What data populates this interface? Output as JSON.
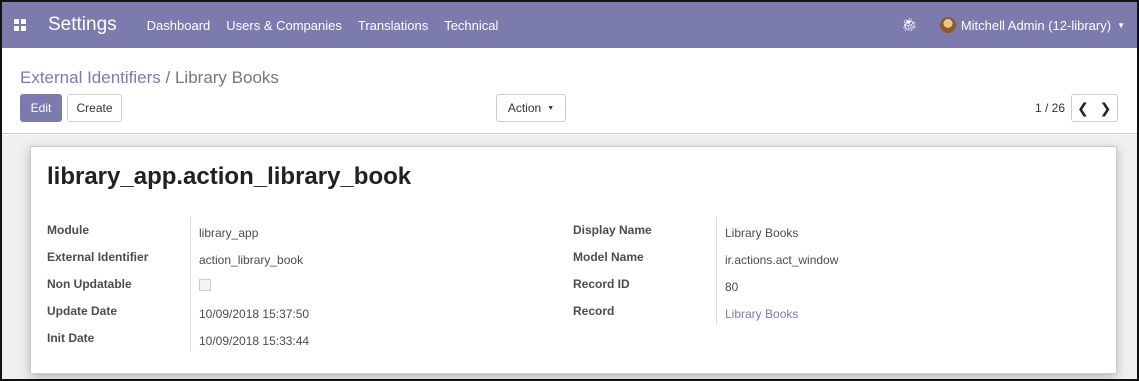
{
  "navbar": {
    "app_title": "Settings",
    "menu": [
      "Dashboard",
      "Users & Companies",
      "Translations",
      "Technical"
    ],
    "user": "Mitchell Admin (12-library)",
    "accent_color": "#7c7bad"
  },
  "breadcrumb": {
    "parent": "External Identifiers",
    "separator": " / ",
    "current": "Library Books"
  },
  "buttons": {
    "edit": "Edit",
    "create": "Create",
    "action": "Action"
  },
  "pager": {
    "value": "1 / 26"
  },
  "record": {
    "title": "library_app.action_library_book",
    "left_fields": [
      {
        "label": "Module",
        "value": "library_app"
      },
      {
        "label": "External Identifier",
        "value": "action_library_book"
      },
      {
        "label": "Non Updatable",
        "value": false
      },
      {
        "label": "Update Date",
        "value": "10/09/2018 15:37:50"
      },
      {
        "label": "Init Date",
        "value": "10/09/2018 15:33:44"
      }
    ],
    "right_fields": [
      {
        "label": "Display Name",
        "value": "Library Books"
      },
      {
        "label": "Model Name",
        "value": "ir.actions.act_window"
      },
      {
        "label": "Record ID",
        "value": "80"
      },
      {
        "label": "Record",
        "value": "Library Books"
      }
    ]
  },
  "icons": {
    "apps": "apps-grid-icon",
    "bug": "bug-icon",
    "prev": "chevron-left-icon",
    "next": "chevron-right-icon",
    "caret": "caret-down-icon"
  }
}
